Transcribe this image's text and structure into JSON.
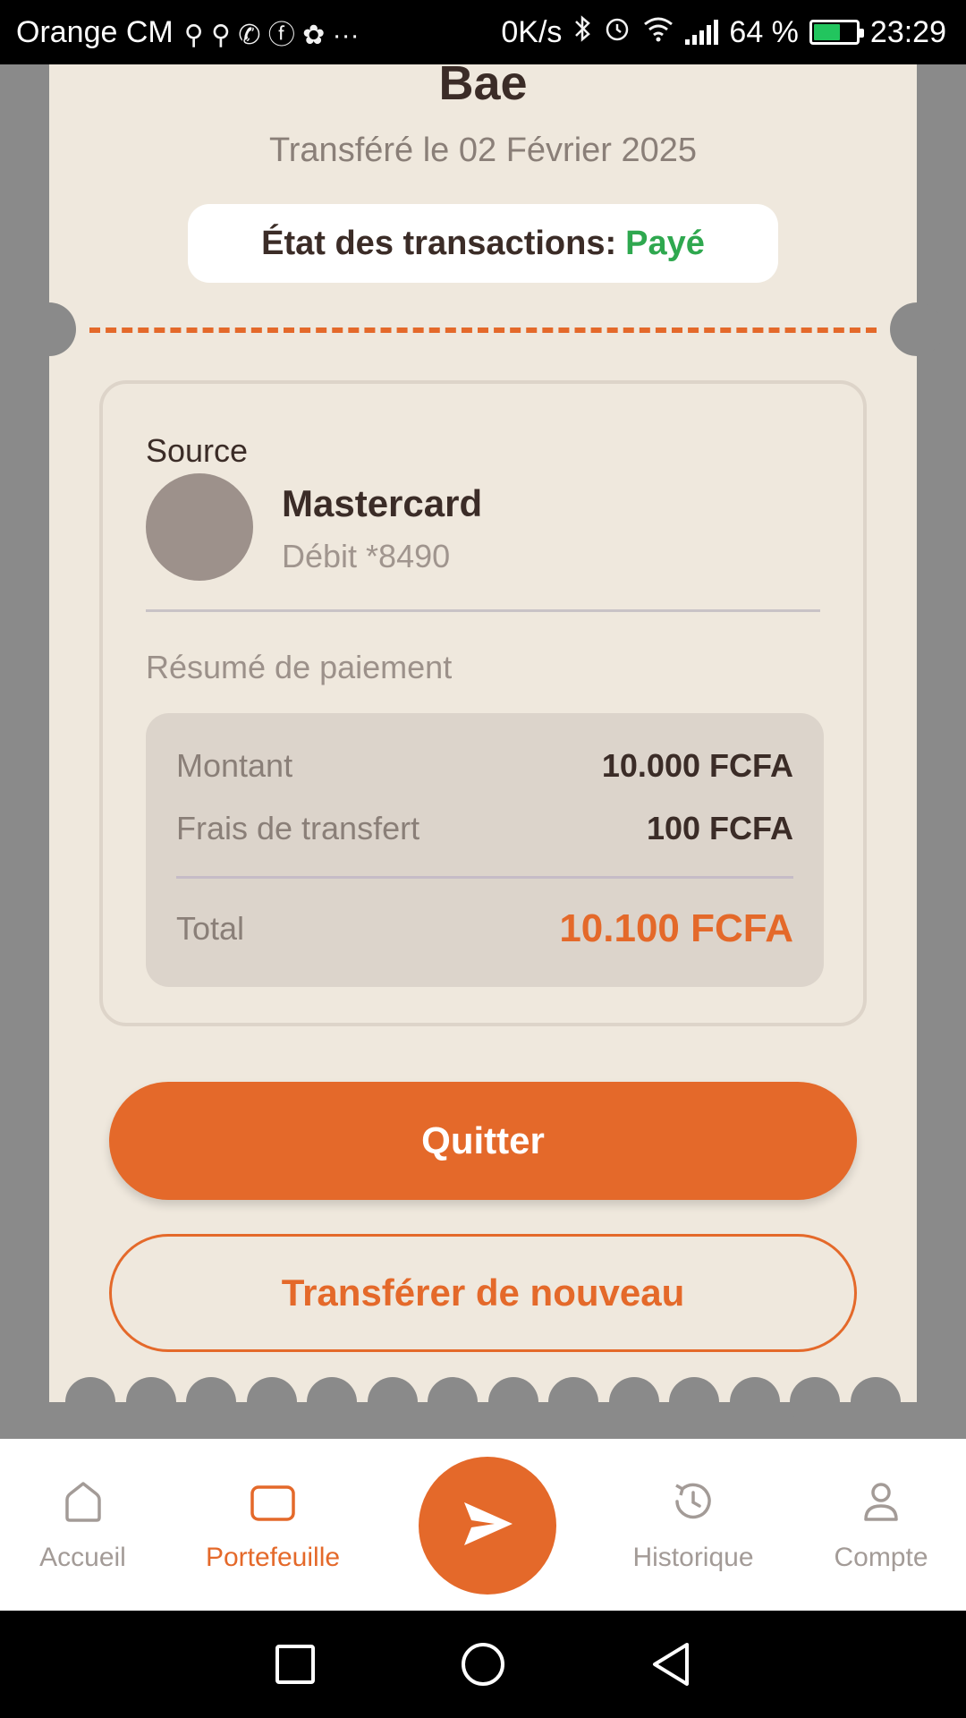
{
  "status_bar": {
    "carrier": "Orange CM",
    "extra_icons": "⚲ ⚲ ✆ ⓕ ✿ ···",
    "net_speed": "0K/s",
    "battery_percent": "64 %",
    "time": "23:29"
  },
  "ticket": {
    "title": "Bae",
    "date": "Transféré le 02 Février 2025",
    "status_label": "État des transactions:",
    "status_value": "Payé",
    "source": {
      "label": "Source",
      "name": "Mastercard",
      "detail": "Débit *8490"
    },
    "summary": {
      "title": "Résumé de paiement",
      "amount_label": "Montant",
      "amount_value": "10.000 FCFA",
      "fee_label": "Frais de transfert",
      "fee_value": "100 FCFA",
      "total_label": "Total",
      "total_value": "10.100 FCFA"
    },
    "buttons": {
      "quit": "Quitter",
      "retransfer": "Transférer de nouveau"
    }
  },
  "bottom_nav": {
    "items": [
      {
        "label": "Accueil",
        "icon": "home-icon",
        "active": false
      },
      {
        "label": "Portefeuille",
        "icon": "wallet-icon",
        "active": true
      },
      {
        "label": "",
        "icon": "send-icon",
        "active": false
      },
      {
        "label": "Historique",
        "icon": "history-icon",
        "active": false
      },
      {
        "label": "Compte",
        "icon": "user-icon",
        "active": false
      }
    ]
  },
  "colors": {
    "accent": "#e4692a",
    "paid_green": "#2fa84f",
    "ticket_bg": "#efe8dd",
    "text_dark": "#3b2c27"
  }
}
